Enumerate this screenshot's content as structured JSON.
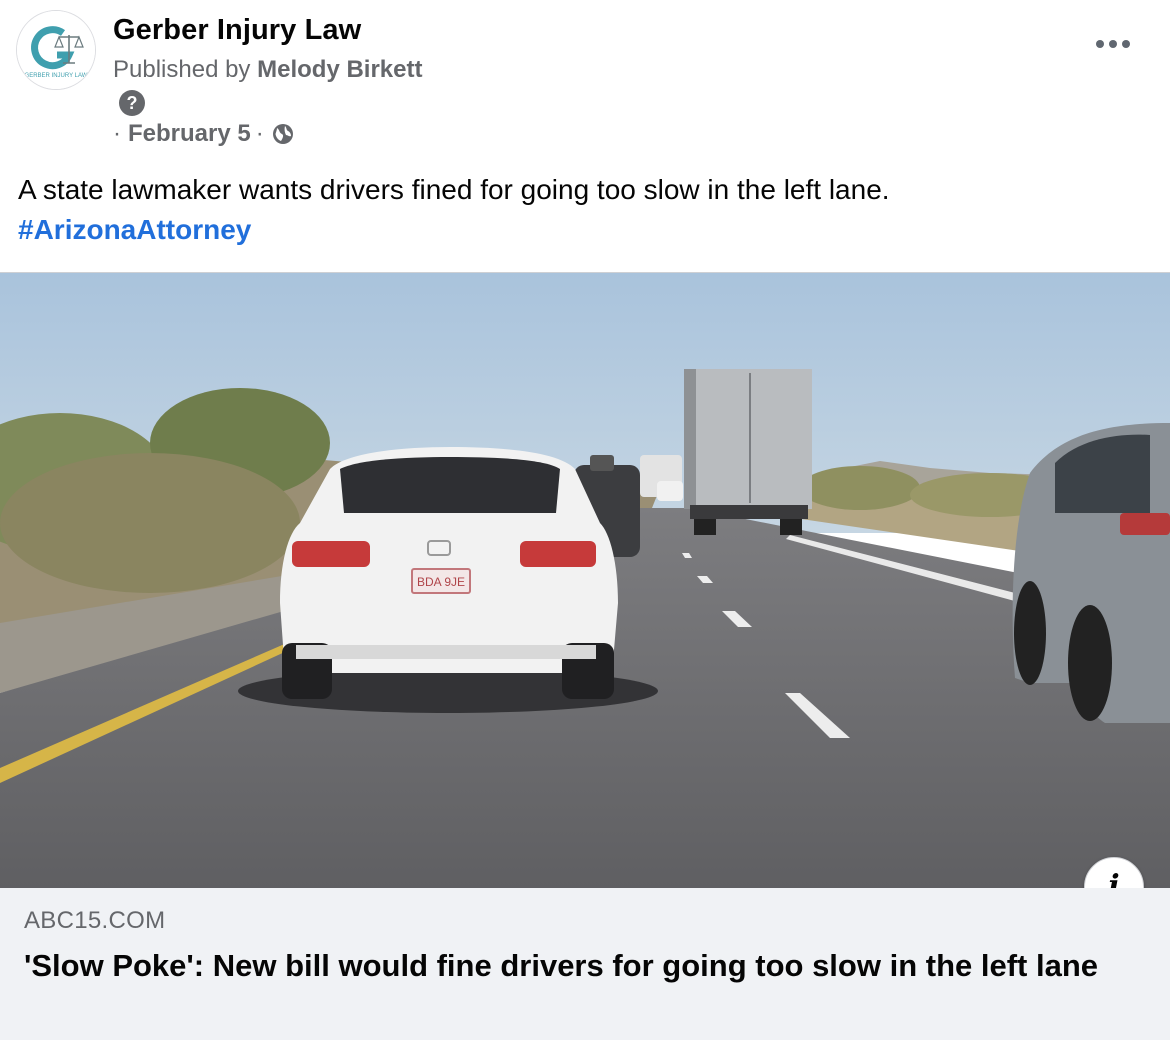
{
  "header": {
    "page_name": "Gerber Injury Law",
    "avatar_text": "GERBER INJURY LAW",
    "published_prefix": "Published by",
    "author": "Melody Birkett",
    "help_icon": "?",
    "date_prefix": "·",
    "date": "February 5",
    "date_suffix": "·",
    "privacy_icon": "globe-icon"
  },
  "post": {
    "text": "A state lawmaker wants drivers fined for going too slow in the left lane.",
    "hashtag": "#ArizonaAttorney"
  },
  "link_preview": {
    "image_description_icon": "info-icon",
    "info_label": "i",
    "license_plate": "BDA 9JE",
    "domain": "ABC15.COM",
    "title": "'Slow Poke': New bill would fine drivers for going too slow in the left lane"
  },
  "colors": {
    "hashtag": "#216fdb",
    "secondary_text": "#65676b",
    "footer_bg": "#f0f2f5",
    "brand_logo": "#2a8a9a"
  }
}
